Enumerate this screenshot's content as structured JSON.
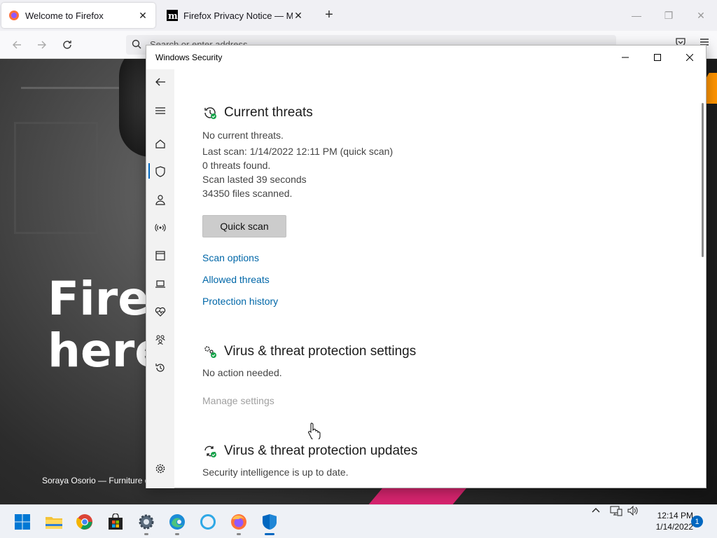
{
  "firefox": {
    "tabs": [
      {
        "label": "Welcome to Firefox",
        "active": true,
        "icon": "firefox-icon"
      },
      {
        "label": "Firefox Privacy Notice — Mozilla",
        "active": false,
        "icon": "mozilla-m-icon"
      }
    ],
    "url_placeholder": "Search or enter address",
    "hero_line1": "Fire",
    "hero_line2": "here",
    "caption": "Soraya Osorio — Furniture d"
  },
  "security": {
    "window_title": "Windows Security",
    "current_threats": {
      "heading": "Current threats",
      "status": "No current threats.",
      "last_scan": "Last scan: 1/14/2022 12:11 PM (quick scan)",
      "threats_found": "0 threats found.",
      "duration": "Scan lasted 39 seconds",
      "files_scanned": "34350 files scanned.",
      "quick_scan_button": "Quick scan",
      "links": [
        "Scan options",
        "Allowed threats",
        "Protection history"
      ]
    },
    "settings": {
      "heading": "Virus & threat protection settings",
      "status": "No action needed.",
      "link": "Manage settings"
    },
    "updates": {
      "heading": "Virus & threat protection updates",
      "status": "Security intelligence is up to date."
    }
  },
  "taskbar": {
    "apps": [
      "start-icon",
      "file-explorer-icon",
      "chrome-icon",
      "store-icon",
      "settings-icon",
      "edge-icon",
      "cortana-icon",
      "firefox-icon",
      "windows-security-icon"
    ],
    "time": "12:14 PM",
    "date": "1/14/2022",
    "notification_count": "1"
  },
  "colors": {
    "accent": "#0067c0",
    "link": "#0067a8",
    "status_ok": "#16a34a"
  }
}
